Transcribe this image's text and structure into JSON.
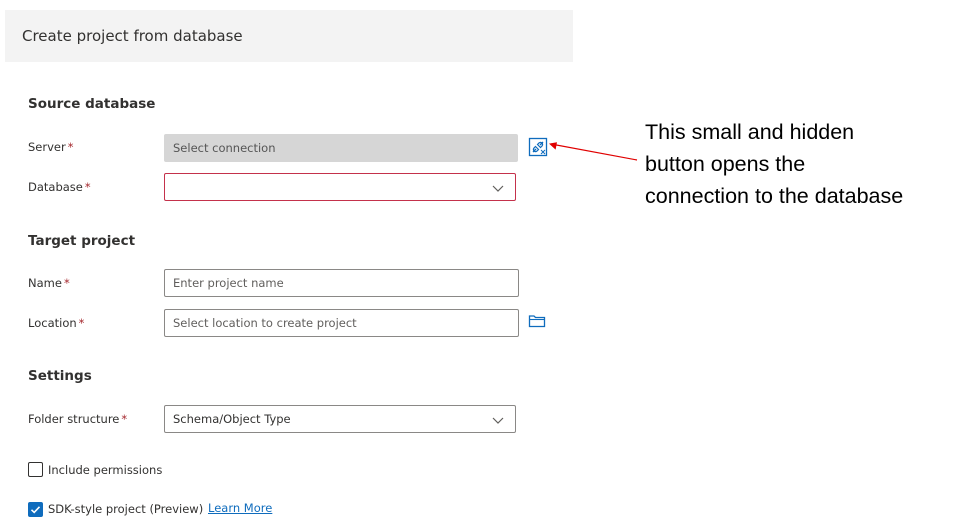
{
  "dialog": {
    "title": "Create project from database"
  },
  "source": {
    "heading": "Source database",
    "server_label": "Server",
    "server_placeholder": "Select connection",
    "database_label": "Database",
    "database_value": ""
  },
  "target": {
    "heading": "Target project",
    "name_label": "Name",
    "name_placeholder": "Enter project name",
    "location_label": "Location",
    "location_placeholder": "Select location to create project"
  },
  "settings": {
    "heading": "Settings",
    "folder_label": "Folder structure",
    "folder_value": "Schema/Object Type",
    "include_permissions_label": "Include permissions",
    "include_permissions_checked": false,
    "sdk_label": "SDK-style project (Preview)",
    "sdk_checked": true,
    "learn_more_label": "Learn More"
  },
  "required_marker": "*",
  "annotation": {
    "line1": "This small and hidden",
    "line2": "button opens the",
    "line3": "connection to the database"
  },
  "colors": {
    "accent": "#0f6cbd",
    "error": "#c4314b",
    "required": "#a4262c",
    "arrow": "#e00000"
  },
  "icons": {
    "connect": "plug-connection-icon",
    "folder": "folder-icon",
    "chevron": "chevron-down-icon",
    "check": "checkmark-icon"
  }
}
